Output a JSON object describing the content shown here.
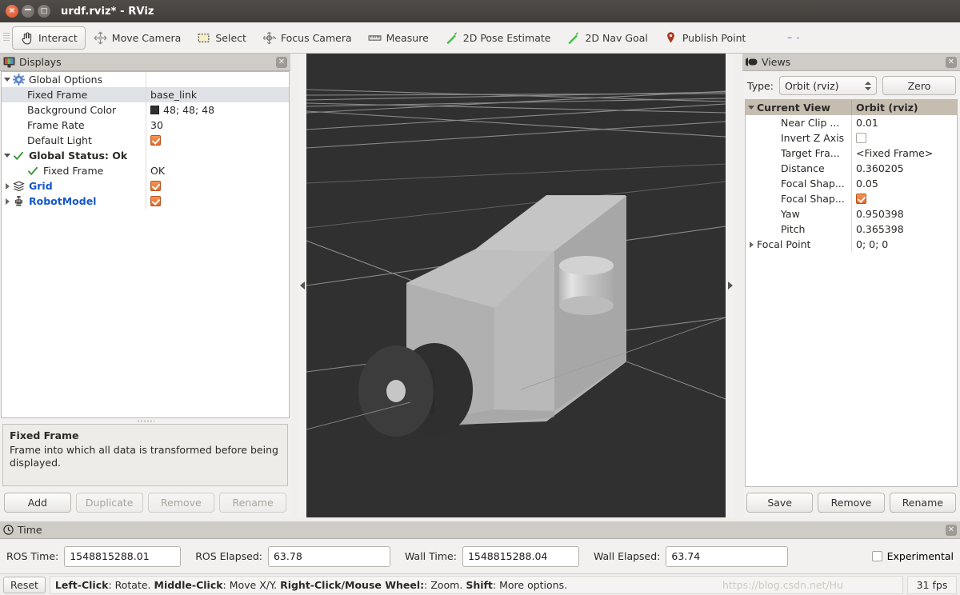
{
  "window": {
    "title": "urdf.rviz* - RViz",
    "close_label": "×",
    "minimize_label": "−",
    "maximize_label": "□"
  },
  "toolbar": {
    "items": [
      {
        "label": "Interact",
        "icon": "hand-cursor-icon",
        "active": true
      },
      {
        "label": "Move Camera",
        "icon": "move-camera-icon",
        "active": false
      },
      {
        "label": "Select",
        "icon": "select-rectangle-icon",
        "active": false
      },
      {
        "label": "Focus Camera",
        "icon": "focus-camera-icon",
        "active": false
      },
      {
        "label": "Measure",
        "icon": "ruler-icon",
        "active": false
      },
      {
        "label": "2D Pose Estimate",
        "icon": "green-arrow-icon",
        "active": false
      },
      {
        "label": "2D Nav Goal",
        "icon": "green-arrow-icon",
        "active": false
      },
      {
        "label": "Publish Point",
        "icon": "map-pin-icon",
        "active": false
      }
    ],
    "add_tool_label": "+",
    "remove_tool_label": "−"
  },
  "displays": {
    "title": "Displays",
    "rows": [
      {
        "name": "Global Options",
        "value": "",
        "indent": 0,
        "arrow": "down",
        "icon": "gear-icon",
        "style": "plain",
        "value_type": "text",
        "selected": false
      },
      {
        "name": "Fixed Frame",
        "value": "base_link",
        "indent": 1,
        "arrow": "none",
        "icon": "none",
        "style": "plain",
        "value_type": "text",
        "selected": true
      },
      {
        "name": "Background Color",
        "value": "48; 48; 48",
        "indent": 1,
        "arrow": "none",
        "icon": "none",
        "style": "plain",
        "value_type": "color",
        "color": "#303030",
        "selected": false
      },
      {
        "name": "Frame Rate",
        "value": "30",
        "indent": 1,
        "arrow": "none",
        "icon": "none",
        "style": "plain",
        "value_type": "text",
        "selected": false
      },
      {
        "name": "Default Light",
        "value": "",
        "indent": 1,
        "arrow": "none",
        "icon": "none",
        "style": "plain",
        "value_type": "checked",
        "selected": false
      },
      {
        "name": "Global Status: Ok",
        "value": "",
        "indent": 0,
        "arrow": "down",
        "icon": "check-icon",
        "style": "bold",
        "value_type": "text",
        "selected": false
      },
      {
        "name": "Fixed Frame",
        "value": "OK",
        "indent": 1,
        "arrow": "none",
        "icon": "check-icon",
        "style": "plain",
        "value_type": "text",
        "selected": false
      },
      {
        "name": "Grid",
        "value": "",
        "indent": 0,
        "arrow": "right",
        "icon": "grid-icon",
        "style": "blue",
        "value_type": "checked",
        "selected": false
      },
      {
        "name": "RobotModel",
        "value": "",
        "indent": 0,
        "arrow": "right",
        "icon": "robot-icon",
        "style": "blue",
        "value_type": "checked",
        "selected": false
      }
    ],
    "description": {
      "title": "Fixed Frame",
      "text": "Frame into which all data is transformed before being displayed."
    },
    "buttons": [
      {
        "label": "Add",
        "enabled": true
      },
      {
        "label": "Duplicate",
        "enabled": false
      },
      {
        "label": "Remove",
        "enabled": false
      },
      {
        "label": "Rename",
        "enabled": false
      }
    ]
  },
  "views": {
    "title": "Views",
    "type_label": "Type:",
    "type_value": "Orbit (rviz)",
    "zero_label": "Zero",
    "header": {
      "name": "Current View",
      "value": "Orbit (rviz)"
    },
    "rows": [
      {
        "name": "Near Clip ...",
        "value": "0.01",
        "indent": 1,
        "arrow": "none",
        "value_type": "text"
      },
      {
        "name": "Invert Z Axis",
        "value": "",
        "indent": 1,
        "arrow": "none",
        "value_type": "unchecked"
      },
      {
        "name": "Target Fra...",
        "value": "<Fixed Frame>",
        "indent": 1,
        "arrow": "none",
        "value_type": "text"
      },
      {
        "name": "Distance",
        "value": "0.360205",
        "indent": 1,
        "arrow": "none",
        "value_type": "text"
      },
      {
        "name": "Focal Shap...",
        "value": "0.05",
        "indent": 1,
        "arrow": "none",
        "value_type": "text"
      },
      {
        "name": "Focal Shap...",
        "value": "",
        "indent": 1,
        "arrow": "none",
        "value_type": "checked"
      },
      {
        "name": "Yaw",
        "value": "0.950398",
        "indent": 1,
        "arrow": "none",
        "value_type": "text"
      },
      {
        "name": "Pitch",
        "value": "0.365398",
        "indent": 1,
        "arrow": "none",
        "value_type": "text"
      },
      {
        "name": "Focal Point",
        "value": "0; 0; 0",
        "indent": 0,
        "arrow": "right",
        "value_type": "text"
      }
    ],
    "buttons": [
      {
        "label": "Save"
      },
      {
        "label": "Remove"
      },
      {
        "label": "Rename"
      }
    ]
  },
  "time": {
    "title": "Time",
    "fields": [
      {
        "label": "ROS Time:",
        "value": "1548815288.01",
        "width": 146
      },
      {
        "label": "ROS Elapsed:",
        "value": "63.78",
        "width": 153
      },
      {
        "label": "Wall Time:",
        "value": "1548815288.04",
        "width": 146
      },
      {
        "label": "Wall Elapsed:",
        "value": "63.74",
        "width": 153
      }
    ],
    "experimental_label": "Experimental"
  },
  "statusbar": {
    "reset_label": "Reset",
    "hint_parts": [
      {
        "text": "Left-Click",
        "bold": true
      },
      {
        "text": ": Rotate.  ",
        "bold": false
      },
      {
        "text": "Middle-Click",
        "bold": true
      },
      {
        "text": ": Move X/Y.  ",
        "bold": false
      },
      {
        "text": "Right-Click/Mouse Wheel:",
        "bold": true
      },
      {
        "text": ": Zoom.  ",
        "bold": false
      },
      {
        "text": "Shift",
        "bold": true
      },
      {
        "text": ": More options.",
        "bold": false
      }
    ],
    "watermark": "https://blog.csdn.net/Hu",
    "fps": "31 fps"
  },
  "viewport": {
    "background_color": "#303030",
    "grid_line_color": "#9a9a9a",
    "model": {
      "body_color_top": "#b9b9b9",
      "body_color_side": "#a8a8a8",
      "body_color_front": "#c0c0c0",
      "cylinder_color": "#cfcfcf",
      "wheel_color": "#3a3a3a",
      "hub_color": "#c9c9c9"
    }
  }
}
